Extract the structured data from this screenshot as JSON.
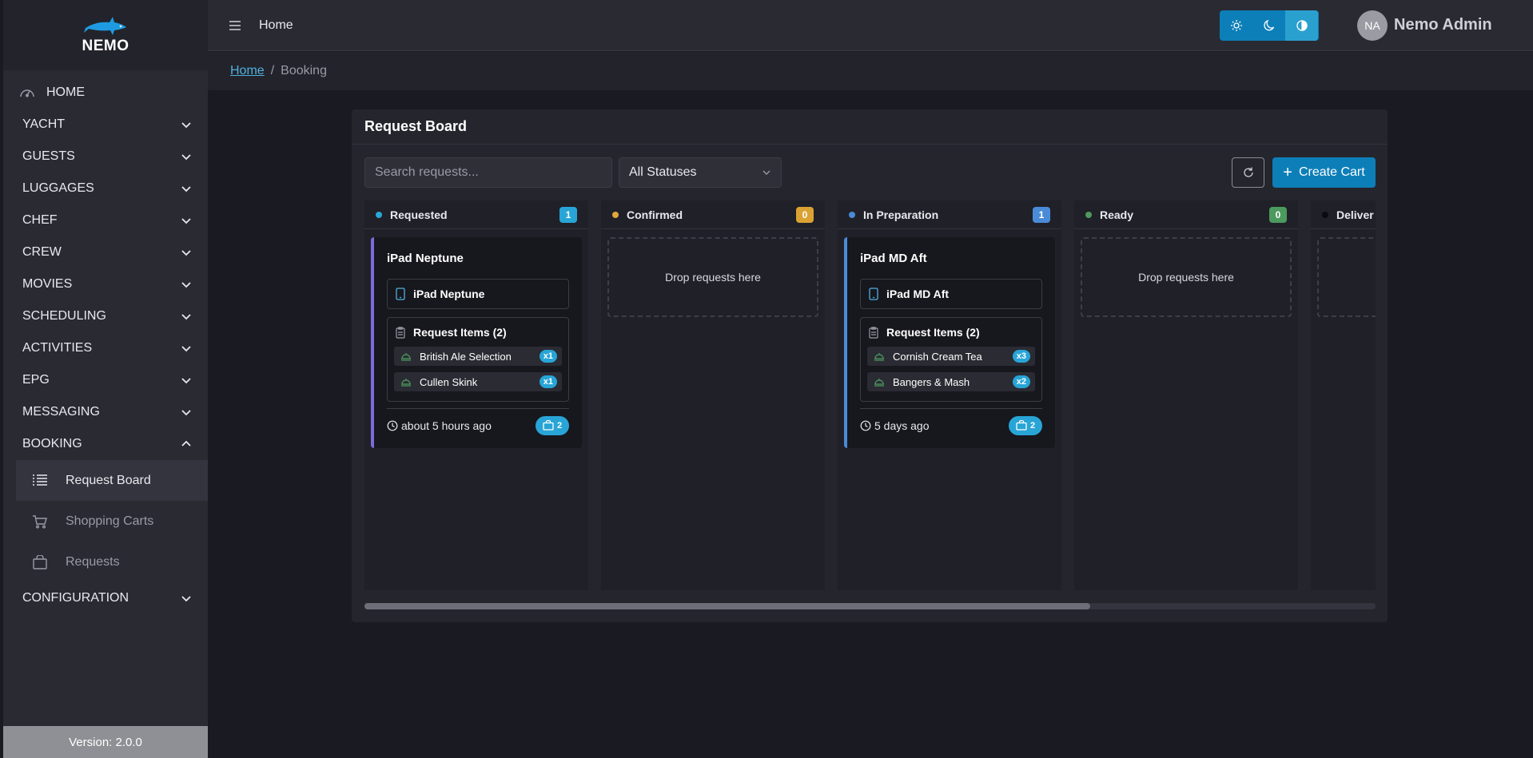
{
  "app": {
    "logo_text": "NEMO",
    "version": "Version: 2.0.0"
  },
  "sidebar": {
    "home": {
      "label": "HOME",
      "icon": "gauge-icon"
    },
    "sections": [
      {
        "label": "YACHT",
        "expanded": false
      },
      {
        "label": "GUESTS",
        "expanded": false
      },
      {
        "label": "LUGGAGES",
        "expanded": false
      },
      {
        "label": "CHEF",
        "expanded": false
      },
      {
        "label": "CREW",
        "expanded": false
      },
      {
        "label": "MOVIES",
        "expanded": false
      },
      {
        "label": "SCHEDULING",
        "expanded": false
      },
      {
        "label": "ACTIVITIES",
        "expanded": false
      },
      {
        "label": "EPG",
        "expanded": false
      },
      {
        "label": "MESSAGING",
        "expanded": false
      },
      {
        "label": "BOOKING",
        "expanded": true
      },
      {
        "label": "CONFIGURATION",
        "expanded": false
      }
    ],
    "booking_items": [
      {
        "label": "Request Board",
        "icon": "list-icon",
        "active": true
      },
      {
        "label": "Shopping Carts",
        "icon": "cart-icon",
        "active": false
      },
      {
        "label": "Requests",
        "icon": "bag-icon",
        "active": false
      }
    ]
  },
  "header": {
    "title": "Home",
    "theme_buttons": [
      "sun-icon",
      "moon-icon",
      "contrast-icon"
    ],
    "active_theme": "contrast-icon",
    "user": {
      "initials": "NA",
      "name": "Nemo Admin"
    }
  },
  "breadcrumb": {
    "home": "Home",
    "separator": "/",
    "current": "Booking"
  },
  "board": {
    "title": "Request Board",
    "search_placeholder": "Search requests...",
    "status_filter": "All Statuses",
    "create_label": "Create Cart",
    "drop_text": "Drop requests here",
    "columns": [
      {
        "name": "Requested",
        "count": "1",
        "dot": "#2aa7d4",
        "badge": "#28a5d6"
      },
      {
        "name": "Confirmed",
        "count": "0",
        "dot": "#e0a83a",
        "badge": "#d9a233"
      },
      {
        "name": "In Preparation",
        "count": "1",
        "dot": "#4a8bd8",
        "badge": "#4a8bd8"
      },
      {
        "name": "Ready",
        "count": "0",
        "dot": "#4c9a5e",
        "badge": "#4c9a5e"
      },
      {
        "name": "Deliver",
        "count": "",
        "dot": "#0a0a12",
        "badge": "#555"
      }
    ],
    "cards": {
      "requested": {
        "title": "iPad Neptune",
        "device": "iPad Neptune",
        "items_label": "Request Items (2)",
        "items": [
          {
            "name": "British Ale Selection",
            "qty": "x1"
          },
          {
            "name": "Cullen Skink",
            "qty": "x1"
          }
        ],
        "time": "about 5 hours ago",
        "cart_count": "2"
      },
      "in_preparation": {
        "title": "iPad MD Aft",
        "device": "iPad MD Aft",
        "items_label": "Request Items (2)",
        "items": [
          {
            "name": "Cornish Cream Tea",
            "qty": "x3"
          },
          {
            "name": "Bangers & Mash",
            "qty": "x2"
          }
        ],
        "time": "5 days ago",
        "cart_count": "2"
      }
    },
    "horizontal_scroll_position": 0.0,
    "horizontal_scroll_visible_fraction": 0.72
  }
}
